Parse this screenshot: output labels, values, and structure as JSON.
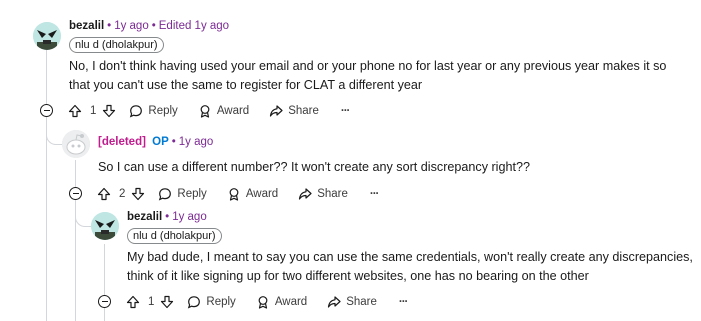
{
  "comments": [
    {
      "author": "bezalil",
      "time": "1y ago",
      "edited": "Edited 1y ago",
      "flair": "nlu d (dholakpur)",
      "body": "No, I don't think having used your email and or your phone no for last year or any previous year makes it so that you can't use the same to register for CLAT a different year",
      "votes": "1",
      "reply": "Reply",
      "award": "Award",
      "share": "Share",
      "more": "···"
    },
    {
      "author": "[deleted]",
      "op": "OP",
      "time": "1y ago",
      "body": "So I can use a different number?? It won't create any sort discrepancy right??",
      "votes": "2",
      "reply": "Reply",
      "award": "Award",
      "share": "Share",
      "more": "···"
    },
    {
      "author": "bezalil",
      "time": "1y ago",
      "flair": "nlu d (dholakpur)",
      "body": "My bad dude, I meant to say you can use the same credentials, won't really create any discrepancies, think of it like signing up for two different websites, one has no bearing on the other",
      "votes": "1",
      "reply": "Reply",
      "award": "Award",
      "share": "Share",
      "more": "···"
    }
  ],
  "colors": {
    "deleted": "#c01d8f",
    "op": "#0079d3",
    "meta": "#7c2b94"
  }
}
